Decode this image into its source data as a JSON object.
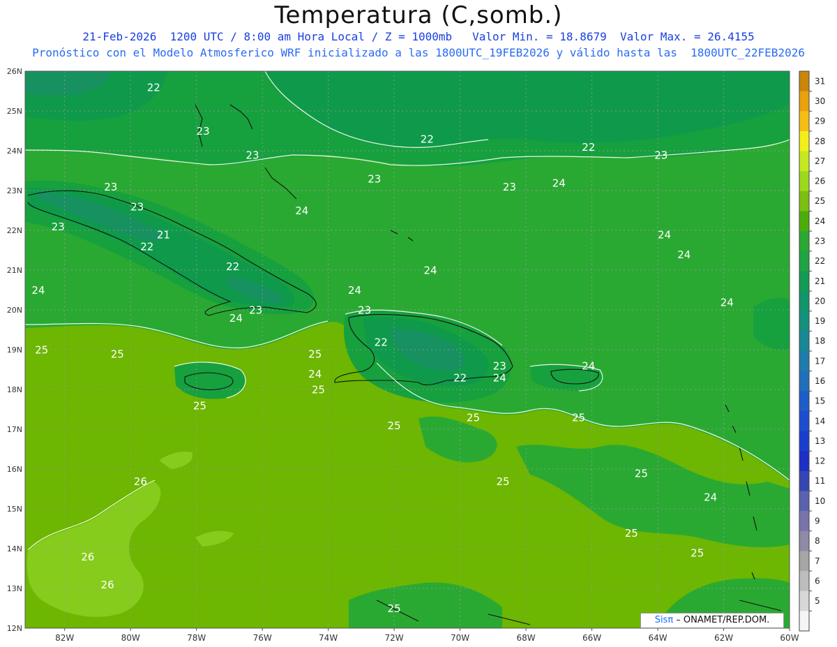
{
  "header": {
    "title": "Temperatura (C,somb.)",
    "subtitle_line1": "21-Feb-2026  1200 UTC / 8:00 am Hora Local / Z = 1000mb   Valor Min. = 18.8679  Valor Max. = 26.4155",
    "subtitle_line2": "Pronóstico con el Modelo Atmosferico WRF inicializado a las 1800UTC_19FEB2026 y válido hasta las  1800UTC_22FEB2026"
  },
  "map": {
    "lon_labels": [
      "82W",
      "80W",
      "78W",
      "76W",
      "74W",
      "72W",
      "70W",
      "68W",
      "66W",
      "64W",
      "62W",
      "60W"
    ],
    "lat_labels": [
      "26N",
      "25N",
      "24N",
      "23N",
      "22N",
      "21N",
      "20N",
      "19N",
      "18N",
      "17N",
      "16N",
      "15N",
      "14N",
      "13N",
      "12N"
    ],
    "colors": {
      "c24": "#2aa932",
      "c25": "#6db601",
      "c23": "#17a03e",
      "c22": "#0e9a4a",
      "c21": "#179160",
      "c26": "#86cc1c",
      "c20": "#1c8a78",
      "grid": "#9a9aa8"
    },
    "contour_labels": [
      {
        "v": "22",
        "lon": -79.3,
        "lat": 25.5
      },
      {
        "v": "23",
        "lon": -77.8,
        "lat": 24.4
      },
      {
        "v": "23",
        "lon": -76.3,
        "lat": 23.8
      },
      {
        "v": "23",
        "lon": -80.6,
        "lat": 23.0
      },
      {
        "v": "23",
        "lon": -79.8,
        "lat": 22.5
      },
      {
        "v": "23",
        "lon": -82.2,
        "lat": 22.0
      },
      {
        "v": "21",
        "lon": -79.0,
        "lat": 21.8
      },
      {
        "v": "22",
        "lon": -79.5,
        "lat": 21.5
      },
      {
        "v": "22",
        "lon": -76.9,
        "lat": 21.0
      },
      {
        "v": "24",
        "lon": -74.8,
        "lat": 22.4
      },
      {
        "v": "24",
        "lon": -82.8,
        "lat": 20.4
      },
      {
        "v": "23",
        "lon": -76.2,
        "lat": 19.9
      },
      {
        "v": "24",
        "lon": -76.8,
        "lat": 19.7
      },
      {
        "v": "24",
        "lon": -73.2,
        "lat": 20.4
      },
      {
        "v": "23",
        "lon": -72.9,
        "lat": 19.9
      },
      {
        "v": "24",
        "lon": -70.9,
        "lat": 20.9
      },
      {
        "v": "22",
        "lon": -72.4,
        "lat": 19.1
      },
      {
        "v": "23",
        "lon": -68.8,
        "lat": 18.5
      },
      {
        "v": "22",
        "lon": -70.0,
        "lat": 18.2
      },
      {
        "v": "24",
        "lon": -68.8,
        "lat": 18.2
      },
      {
        "v": "22",
        "lon": -71.0,
        "lat": 24.2
      },
      {
        "v": "23",
        "lon": -72.6,
        "lat": 23.2
      },
      {
        "v": "23",
        "lon": -68.5,
        "lat": 23.0
      },
      {
        "v": "24",
        "lon": -67.0,
        "lat": 23.1
      },
      {
        "v": "22",
        "lon": -66.1,
        "lat": 24.0
      },
      {
        "v": "23",
        "lon": -63.9,
        "lat": 23.8
      },
      {
        "v": "24",
        "lon": -63.8,
        "lat": 21.8
      },
      {
        "v": "24",
        "lon": -63.2,
        "lat": 21.3
      },
      {
        "v": "24",
        "lon": -61.9,
        "lat": 20.1
      },
      {
        "v": "24",
        "lon": -66.1,
        "lat": 18.5
      },
      {
        "v": "25",
        "lon": -82.7,
        "lat": 18.9
      },
      {
        "v": "25",
        "lon": -80.4,
        "lat": 18.8
      },
      {
        "v": "25",
        "lon": -77.9,
        "lat": 17.5
      },
      {
        "v": "25",
        "lon": -74.4,
        "lat": 18.8
      },
      {
        "v": "24",
        "lon": -74.4,
        "lat": 18.3
      },
      {
        "v": "25",
        "lon": -74.3,
        "lat": 17.9
      },
      {
        "v": "25",
        "lon": -72.0,
        "lat": 17.0
      },
      {
        "v": "25",
        "lon": -69.6,
        "lat": 17.2
      },
      {
        "v": "25",
        "lon": -66.4,
        "lat": 17.2
      },
      {
        "v": "25",
        "lon": -68.7,
        "lat": 15.6
      },
      {
        "v": "25",
        "lon": -64.5,
        "lat": 15.8
      },
      {
        "v": "24",
        "lon": -62.4,
        "lat": 15.2
      },
      {
        "v": "25",
        "lon": -64.8,
        "lat": 14.3
      },
      {
        "v": "25",
        "lon": -62.8,
        "lat": 13.8
      },
      {
        "v": "26",
        "lon": -79.7,
        "lat": 15.6
      },
      {
        "v": "26",
        "lon": -81.3,
        "lat": 13.7
      },
      {
        "v": "26",
        "lon": -80.7,
        "lat": 13.0
      },
      {
        "v": "25",
        "lon": -72.0,
        "lat": 12.4
      }
    ],
    "colorbar": {
      "levels": [
        "31",
        "30",
        "29",
        "28",
        "27",
        "26",
        "25",
        "24",
        "23",
        "22",
        "21",
        "20",
        "19",
        "18",
        "17",
        "16",
        "15",
        "14",
        "13",
        "12",
        "11",
        "10",
        "9",
        "8",
        "7",
        "6",
        "5"
      ],
      "colors": [
        "#c98609",
        "#e9a10c",
        "#f5be12",
        "#f4ef1a",
        "#c6e820",
        "#9dd91b",
        "#7cbf10",
        "#4cad0a",
        "#2aa932",
        "#1fa443",
        "#149b55",
        "#11966a",
        "#13917e",
        "#198896",
        "#1e7dac",
        "#1f6fbd",
        "#1d5ec9",
        "#1b4ed1",
        "#1a3ecf",
        "#1c2fc6",
        "#3546b4",
        "#5a62ad",
        "#7874ab",
        "#8e8aa8",
        "#a6a6a6",
        "#bdbdbd",
        "#d7d7d7",
        "#f5f5f5"
      ]
    }
  },
  "credit": {
    "sis": "Sisπ",
    "text": " – ONAMET/REP.DOM."
  }
}
